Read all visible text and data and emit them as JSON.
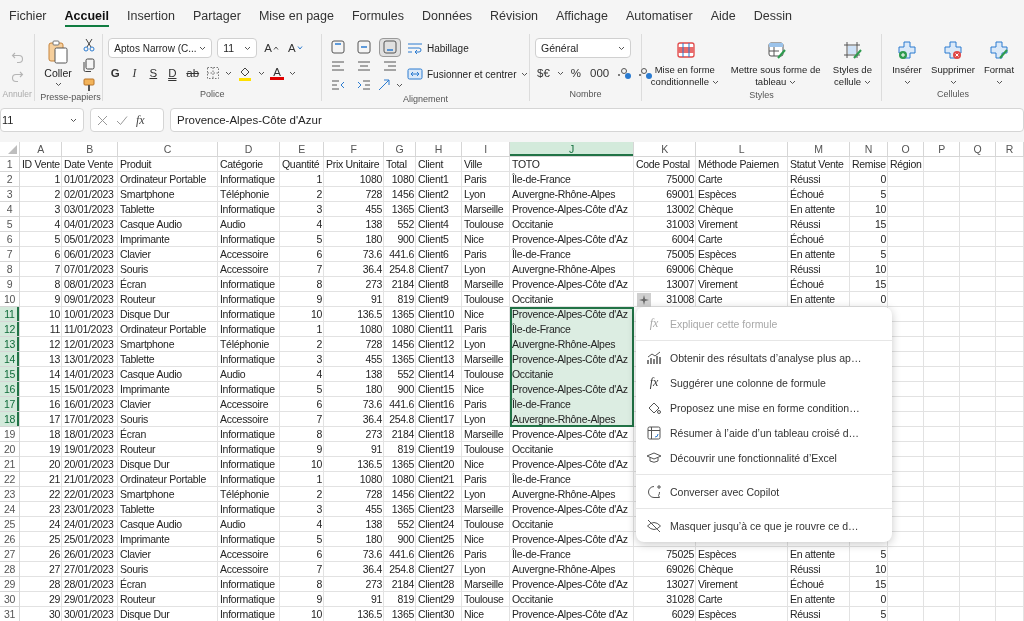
{
  "menu_tabs": [
    {
      "label": "Fichier",
      "selected": false
    },
    {
      "label": "Accueil",
      "selected": true
    },
    {
      "label": "Insertion",
      "selected": false
    },
    {
      "label": "Partager",
      "selected": false
    },
    {
      "label": "Mise en page",
      "selected": false
    },
    {
      "label": "Formules",
      "selected": false
    },
    {
      "label": "Données",
      "selected": false
    },
    {
      "label": "Révision",
      "selected": false
    },
    {
      "label": "Affichage",
      "selected": false
    },
    {
      "label": "Automatiser",
      "selected": false
    },
    {
      "label": "Aide",
      "selected": false
    },
    {
      "label": "Dessin",
      "selected": false
    }
  ],
  "ribbon": {
    "undo": {
      "label": "Annuler",
      "disabled": true
    },
    "clipboard": {
      "paste": "Coller",
      "label": "Presse-papiers"
    },
    "font": {
      "family": "Aptos Narrow (C...",
      "size": "11",
      "grow": "A",
      "shrink": "A",
      "styles": [
        "G",
        "I",
        "S",
        "D",
        "ab"
      ],
      "color_letter": "A",
      "label": "Police"
    },
    "alignment": {
      "buttons": [
        {
          "selected": false
        },
        {
          "selected": false
        },
        {
          "selected": true
        }
      ],
      "wrap": "Habillage",
      "merge": "Fusionner et centrer",
      "label": "Alignement"
    },
    "number": {
      "format": "Général",
      "buttons": [
        "$€",
        "%",
        "000"
      ],
      "label": "Nombre"
    },
    "styles": {
      "buttons": [
        "Mise en forme conditionnelle",
        "Mettre sous forme de tableau",
        "Styles de cellule"
      ],
      "label": "Styles"
    },
    "cells": {
      "buttons": [
        "Insérer",
        "Supprimer",
        "Format"
      ],
      "label": "Cellules"
    }
  },
  "formula_bar": {
    "name_box": "11",
    "fx": "fx",
    "value": "Provence-Alpes-Côte d'Azur"
  },
  "sheet": {
    "columns": [
      {
        "label": "A",
        "selected": false
      },
      {
        "label": "B",
        "selected": false
      },
      {
        "label": "C",
        "selected": false
      },
      {
        "label": "D",
        "selected": false
      },
      {
        "label": "E",
        "selected": false
      },
      {
        "label": "F",
        "selected": false
      },
      {
        "label": "G",
        "selected": false
      },
      {
        "label": "H",
        "selected": false
      },
      {
        "label": "I",
        "selected": false
      },
      {
        "label": "J",
        "selected": true
      },
      {
        "label": "K",
        "selected": false
      },
      {
        "label": "L",
        "selected": false
      },
      {
        "label": "M",
        "selected": false
      },
      {
        "label": "N",
        "selected": false
      },
      {
        "label": "O",
        "selected": false
      },
      {
        "label": "P",
        "selected": false
      },
      {
        "label": "Q",
        "selected": false
      },
      {
        "label": "R",
        "selected": false
      }
    ],
    "rows": [
      {
        "number": "1",
        "selected": false,
        "cells": [
          "ID Vente",
          "Date Vente",
          "Produit",
          "Catégorie",
          "Quantité",
          "Prix Unitaire",
          "Total",
          "Client",
          "Ville",
          "TOTO",
          "Code Postal",
          "Méthode Paiemen",
          "Statut Vente",
          "Remise",
          "Région"
        ]
      },
      {
        "number": "2",
        "selected": false,
        "cells": [
          "1",
          "01/01/2023",
          "Ordinateur Portable",
          "Informatique",
          "1",
          "1080",
          "1080",
          "Client1",
          "Paris",
          "Île-de-France",
          "75000",
          "Carte",
          "Réussi",
          "0"
        ]
      },
      {
        "number": "3",
        "selected": false,
        "cells": [
          "2",
          "02/01/2023",
          "Smartphone",
          "Téléphonie",
          "2",
          "728",
          "1456",
          "Client2",
          "Lyon",
          "Auvergne-Rhône-Alpes",
          "69001",
          "Espèces",
          "Échoué",
          "5"
        ]
      },
      {
        "number": "4",
        "selected": false,
        "cells": [
          "3",
          "03/01/2023",
          "Tablette",
          "Informatique",
          "3",
          "455",
          "1365",
          "Client3",
          "Marseille",
          "Provence-Alpes-Côte d'Az",
          "13002",
          "Chèque",
          "En attente",
          "10"
        ]
      },
      {
        "number": "5",
        "selected": false,
        "cells": [
          "4",
          "04/01/2023",
          "Casque Audio",
          "Audio",
          "4",
          "138",
          "552",
          "Client4",
          "Toulouse",
          "Occitanie",
          "31003",
          "Virement",
          "Réussi",
          "15"
        ]
      },
      {
        "number": "6",
        "selected": false,
        "cells": [
          "5",
          "05/01/2023",
          "Imprimante",
          "Informatique",
          "5",
          "180",
          "900",
          "Client5",
          "Nice",
          "Provence-Alpes-Côte d'Az",
          "6004",
          "Carte",
          "Échoué",
          "0"
        ]
      },
      {
        "number": "7",
        "selected": false,
        "cells": [
          "6",
          "06/01/2023",
          "Clavier",
          "Accessoire",
          "6",
          "73.6",
          "441.6",
          "Client6",
          "Paris",
          "Île-de-France",
          "75005",
          "Espèces",
          "En attente",
          "5"
        ]
      },
      {
        "number": "8",
        "selected": false,
        "cells": [
          "7",
          "07/01/2023",
          "Souris",
          "Accessoire",
          "7",
          "36.4",
          "254.8",
          "Client7",
          "Lyon",
          "Auvergne-Rhône-Alpes",
          "69006",
          "Chèque",
          "Réussi",
          "10"
        ]
      },
      {
        "number": "9",
        "selected": false,
        "cells": [
          "8",
          "08/01/2023",
          "Écran",
          "Informatique",
          "8",
          "273",
          "2184",
          "Client8",
          "Marseille",
          "Provence-Alpes-Côte d'Az",
          "13007",
          "Virement",
          "Échoué",
          "15"
        ]
      },
      {
        "number": "10",
        "selected": false,
        "cells": [
          "9",
          "09/01/2023",
          "Routeur",
          "Informatique",
          "9",
          "91",
          "819",
          "Client9",
          "Toulouse",
          "Occitanie",
          "31008",
          "Carte",
          "En attente",
          "0"
        ]
      },
      {
        "number": "11",
        "selected": true,
        "cells": [
          "10",
          "10/01/2023",
          "Disque Dur",
          "Informatique",
          "10",
          "136.5",
          "1365",
          "Client10",
          "Nice",
          "Provence-Alpes-Côte d'Az"
        ]
      },
      {
        "number": "12",
        "selected": true,
        "cells": [
          "11",
          "11/01/2023",
          "Ordinateur Portable",
          "Informatique",
          "1",
          "1080",
          "1080",
          "Client11",
          "Paris",
          "Île-de-France"
        ]
      },
      {
        "number": "13",
        "selected": true,
        "cells": [
          "12",
          "12/01/2023",
          "Smartphone",
          "Téléphonie",
          "2",
          "728",
          "1456",
          "Client12",
          "Lyon",
          "Auvergne-Rhône-Alpes"
        ]
      },
      {
        "number": "14",
        "selected": true,
        "cells": [
          "13",
          "13/01/2023",
          "Tablette",
          "Informatique",
          "3",
          "455",
          "1365",
          "Client13",
          "Marseille",
          "Provence-Alpes-Côte d'Az"
        ]
      },
      {
        "number": "15",
        "selected": true,
        "cells": [
          "14",
          "14/01/2023",
          "Casque Audio",
          "Audio",
          "4",
          "138",
          "552",
          "Client14",
          "Toulouse",
          "Occitanie"
        ]
      },
      {
        "number": "16",
        "selected": true,
        "cells": [
          "15",
          "15/01/2023",
          "Imprimante",
          "Informatique",
          "5",
          "180",
          "900",
          "Client15",
          "Nice",
          "Provence-Alpes-Côte d'Az"
        ]
      },
      {
        "number": "17",
        "selected": true,
        "cells": [
          "16",
          "16/01/2023",
          "Clavier",
          "Accessoire",
          "6",
          "73.6",
          "441.6",
          "Client16",
          "Paris",
          "Île-de-France"
        ]
      },
      {
        "number": "18",
        "selected": true,
        "cells": [
          "17",
          "17/01/2023",
          "Souris",
          "Accessoire",
          "7",
          "36.4",
          "254.8",
          "Client17",
          "Lyon",
          "Auvergne-Rhône-Alpes"
        ]
      },
      {
        "number": "19",
        "selected": false,
        "cells": [
          "18",
          "18/01/2023",
          "Écran",
          "Informatique",
          "8",
          "273",
          "2184",
          "Client18",
          "Marseille",
          "Provence-Alpes-Côte d'Az"
        ]
      },
      {
        "number": "20",
        "selected": false,
        "cells": [
          "19",
          "19/01/2023",
          "Routeur",
          "Informatique",
          "9",
          "91",
          "819",
          "Client19",
          "Toulouse",
          "Occitanie"
        ]
      },
      {
        "number": "21",
        "selected": false,
        "cells": [
          "20",
          "20/01/2023",
          "Disque Dur",
          "Informatique",
          "10",
          "136.5",
          "1365",
          "Client20",
          "Nice",
          "Provence-Alpes-Côte d'Az"
        ]
      },
      {
        "number": "22",
        "selected": false,
        "cells": [
          "21",
          "21/01/2023",
          "Ordinateur Portable",
          "Informatique",
          "1",
          "1080",
          "1080",
          "Client21",
          "Paris",
          "Île-de-France"
        ]
      },
      {
        "number": "23",
        "selected": false,
        "cells": [
          "22",
          "22/01/2023",
          "Smartphone",
          "Téléphonie",
          "2",
          "728",
          "1456",
          "Client22",
          "Lyon",
          "Auvergne-Rhône-Alpes"
        ]
      },
      {
        "number": "24",
        "selected": false,
        "cells": [
          "23",
          "23/01/2023",
          "Tablette",
          "Informatique",
          "3",
          "455",
          "1365",
          "Client23",
          "Marseille",
          "Provence-Alpes-Côte d'Az"
        ]
      },
      {
        "number": "25",
        "selected": false,
        "cells": [
          "24",
          "24/01/2023",
          "Casque Audio",
          "Audio",
          "4",
          "138",
          "552",
          "Client24",
          "Toulouse",
          "Occitanie"
        ]
      },
      {
        "number": "26",
        "selected": false,
        "cells": [
          "25",
          "25/01/2023",
          "Imprimante",
          "Informatique",
          "5",
          "180",
          "900",
          "Client25",
          "Nice",
          "Provence-Alpes-Côte d'Az"
        ]
      },
      {
        "number": "27",
        "selected": false,
        "cells": [
          "26",
          "26/01/2023",
          "Clavier",
          "Accessoire",
          "6",
          "73.6",
          "441.6",
          "Client26",
          "Paris",
          "Île-de-France",
          "75025",
          "Espèces",
          "En attente",
          "5"
        ]
      },
      {
        "number": "28",
        "selected": false,
        "cells": [
          "27",
          "27/01/2023",
          "Souris",
          "Accessoire",
          "7",
          "36.4",
          "254.8",
          "Client27",
          "Lyon",
          "Auvergne-Rhône-Alpes",
          "69026",
          "Chèque",
          "Réussi",
          "10"
        ]
      },
      {
        "number": "29",
        "selected": false,
        "cells": [
          "28",
          "28/01/2023",
          "Écran",
          "Informatique",
          "8",
          "273",
          "2184",
          "Client28",
          "Marseille",
          "Provence-Alpes-Côte d'Az",
          "13027",
          "Virement",
          "Échoué",
          "15"
        ]
      },
      {
        "number": "30",
        "selected": false,
        "cells": [
          "29",
          "29/01/2023",
          "Routeur",
          "Informatique",
          "9",
          "91",
          "819",
          "Client29",
          "Toulouse",
          "Occitanie",
          "31028",
          "Carte",
          "En attente",
          "0"
        ]
      },
      {
        "number": "31",
        "selected": false,
        "cells": [
          "30",
          "30/01/2023",
          "Disque Dur",
          "Informatique",
          "10",
          "136.5",
          "1365",
          "Client30",
          "Nice",
          "Provence-Alpes-Côte d'Az",
          "6029",
          "Espèces",
          "Réussi",
          "5"
        ]
      }
    ]
  },
  "menu": {
    "groups": [
      {
        "items": [
          {
            "kind": "formula",
            "glyph": "fx",
            "label": "Expliquer cette formule",
            "disabled": true
          }
        ]
      },
      {
        "items": [
          {
            "kind": "chart",
            "label": "Obtenir des résultats d’analyse plus ap…",
            "disabled": false
          },
          {
            "kind": "formula",
            "glyph": "fx",
            "label": "Suggérer une colonne de formule",
            "disabled": false
          },
          {
            "kind": "paint",
            "label": "Proposez une mise en forme condition…",
            "disabled": false
          },
          {
            "kind": "pivot",
            "label": "Résumer à l’aide d’un tableau croisé d…",
            "disabled": false
          },
          {
            "kind": "learn",
            "label": "Découvrir une fonctionnalité d’Excel",
            "disabled": false
          }
        ]
      },
      {
        "items": [
          {
            "kind": "chat",
            "label": "Converser avec Copilot",
            "disabled": false
          }
        ]
      },
      {
        "items": [
          {
            "kind": "hide",
            "label": "Masquer jusqu’à ce que je rouvre ce d…",
            "disabled": false
          }
        ]
      }
    ]
  }
}
